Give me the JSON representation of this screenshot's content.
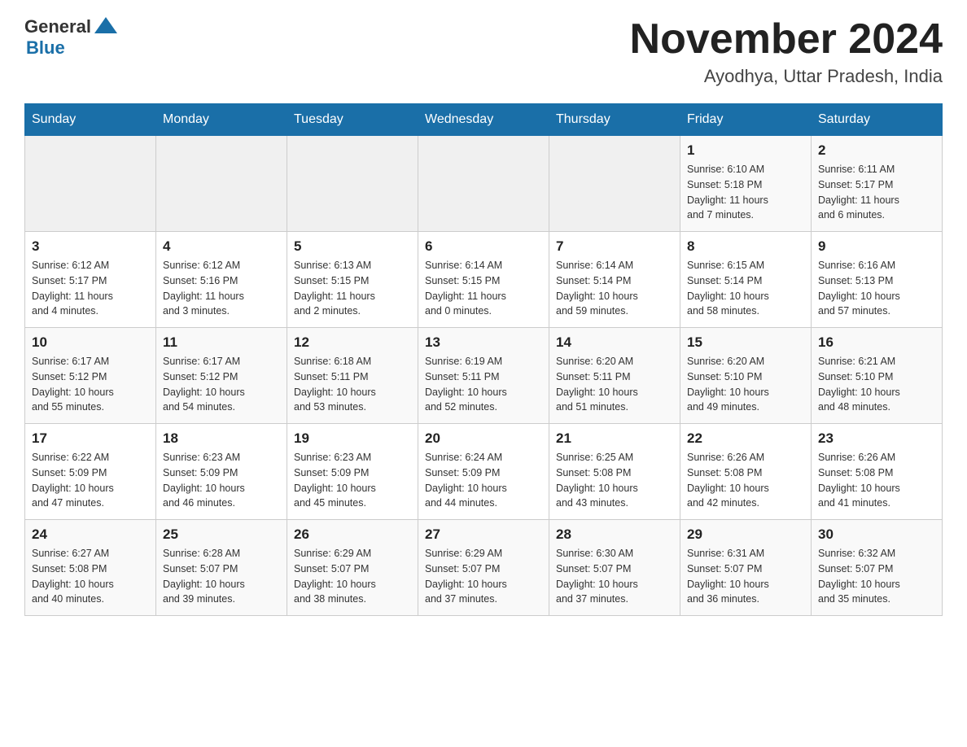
{
  "header": {
    "logo_general": "General",
    "logo_blue": "Blue",
    "month_year": "November 2024",
    "location": "Ayodhya, Uttar Pradesh, India"
  },
  "weekdays": [
    "Sunday",
    "Monday",
    "Tuesday",
    "Wednesday",
    "Thursday",
    "Friday",
    "Saturday"
  ],
  "weeks": [
    [
      {
        "day": "",
        "info": ""
      },
      {
        "day": "",
        "info": ""
      },
      {
        "day": "",
        "info": ""
      },
      {
        "day": "",
        "info": ""
      },
      {
        "day": "",
        "info": ""
      },
      {
        "day": "1",
        "info": "Sunrise: 6:10 AM\nSunset: 5:18 PM\nDaylight: 11 hours\nand 7 minutes."
      },
      {
        "day": "2",
        "info": "Sunrise: 6:11 AM\nSunset: 5:17 PM\nDaylight: 11 hours\nand 6 minutes."
      }
    ],
    [
      {
        "day": "3",
        "info": "Sunrise: 6:12 AM\nSunset: 5:17 PM\nDaylight: 11 hours\nand 4 minutes."
      },
      {
        "day": "4",
        "info": "Sunrise: 6:12 AM\nSunset: 5:16 PM\nDaylight: 11 hours\nand 3 minutes."
      },
      {
        "day": "5",
        "info": "Sunrise: 6:13 AM\nSunset: 5:15 PM\nDaylight: 11 hours\nand 2 minutes."
      },
      {
        "day": "6",
        "info": "Sunrise: 6:14 AM\nSunset: 5:15 PM\nDaylight: 11 hours\nand 0 minutes."
      },
      {
        "day": "7",
        "info": "Sunrise: 6:14 AM\nSunset: 5:14 PM\nDaylight: 10 hours\nand 59 minutes."
      },
      {
        "day": "8",
        "info": "Sunrise: 6:15 AM\nSunset: 5:14 PM\nDaylight: 10 hours\nand 58 minutes."
      },
      {
        "day": "9",
        "info": "Sunrise: 6:16 AM\nSunset: 5:13 PM\nDaylight: 10 hours\nand 57 minutes."
      }
    ],
    [
      {
        "day": "10",
        "info": "Sunrise: 6:17 AM\nSunset: 5:12 PM\nDaylight: 10 hours\nand 55 minutes."
      },
      {
        "day": "11",
        "info": "Sunrise: 6:17 AM\nSunset: 5:12 PM\nDaylight: 10 hours\nand 54 minutes."
      },
      {
        "day": "12",
        "info": "Sunrise: 6:18 AM\nSunset: 5:11 PM\nDaylight: 10 hours\nand 53 minutes."
      },
      {
        "day": "13",
        "info": "Sunrise: 6:19 AM\nSunset: 5:11 PM\nDaylight: 10 hours\nand 52 minutes."
      },
      {
        "day": "14",
        "info": "Sunrise: 6:20 AM\nSunset: 5:11 PM\nDaylight: 10 hours\nand 51 minutes."
      },
      {
        "day": "15",
        "info": "Sunrise: 6:20 AM\nSunset: 5:10 PM\nDaylight: 10 hours\nand 49 minutes."
      },
      {
        "day": "16",
        "info": "Sunrise: 6:21 AM\nSunset: 5:10 PM\nDaylight: 10 hours\nand 48 minutes."
      }
    ],
    [
      {
        "day": "17",
        "info": "Sunrise: 6:22 AM\nSunset: 5:09 PM\nDaylight: 10 hours\nand 47 minutes."
      },
      {
        "day": "18",
        "info": "Sunrise: 6:23 AM\nSunset: 5:09 PM\nDaylight: 10 hours\nand 46 minutes."
      },
      {
        "day": "19",
        "info": "Sunrise: 6:23 AM\nSunset: 5:09 PM\nDaylight: 10 hours\nand 45 minutes."
      },
      {
        "day": "20",
        "info": "Sunrise: 6:24 AM\nSunset: 5:09 PM\nDaylight: 10 hours\nand 44 minutes."
      },
      {
        "day": "21",
        "info": "Sunrise: 6:25 AM\nSunset: 5:08 PM\nDaylight: 10 hours\nand 43 minutes."
      },
      {
        "day": "22",
        "info": "Sunrise: 6:26 AM\nSunset: 5:08 PM\nDaylight: 10 hours\nand 42 minutes."
      },
      {
        "day": "23",
        "info": "Sunrise: 6:26 AM\nSunset: 5:08 PM\nDaylight: 10 hours\nand 41 minutes."
      }
    ],
    [
      {
        "day": "24",
        "info": "Sunrise: 6:27 AM\nSunset: 5:08 PM\nDaylight: 10 hours\nand 40 minutes."
      },
      {
        "day": "25",
        "info": "Sunrise: 6:28 AM\nSunset: 5:07 PM\nDaylight: 10 hours\nand 39 minutes."
      },
      {
        "day": "26",
        "info": "Sunrise: 6:29 AM\nSunset: 5:07 PM\nDaylight: 10 hours\nand 38 minutes."
      },
      {
        "day": "27",
        "info": "Sunrise: 6:29 AM\nSunset: 5:07 PM\nDaylight: 10 hours\nand 37 minutes."
      },
      {
        "day": "28",
        "info": "Sunrise: 6:30 AM\nSunset: 5:07 PM\nDaylight: 10 hours\nand 37 minutes."
      },
      {
        "day": "29",
        "info": "Sunrise: 6:31 AM\nSunset: 5:07 PM\nDaylight: 10 hours\nand 36 minutes."
      },
      {
        "day": "30",
        "info": "Sunrise: 6:32 AM\nSunset: 5:07 PM\nDaylight: 10 hours\nand 35 minutes."
      }
    ]
  ]
}
